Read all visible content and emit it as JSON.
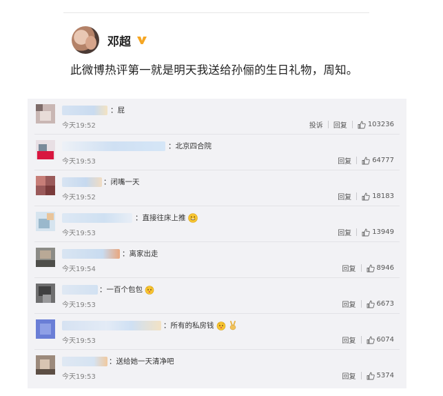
{
  "post": {
    "author": "邓超",
    "text": "此微博热评第一就是明天我送给孙俪的生日礼物，周知。"
  },
  "labels": {
    "report": "投诉",
    "reply": "回复"
  },
  "comments": [
    {
      "text": "：屁",
      "time": "今天19:52",
      "likes": "103236",
      "has_report": true
    },
    {
      "text": "：北京四合院",
      "time": "今天19:53",
      "likes": "64777"
    },
    {
      "text": "：闭嘴一天",
      "time": "今天19:52",
      "likes": "18183"
    },
    {
      "text": "：直接往床上推",
      "time": "今天19:53",
      "likes": "13949"
    },
    {
      "text": "：离家出走",
      "time": "今天19:54",
      "likes": "8946"
    },
    {
      "text": "：一百个包包",
      "time": "今天19:53",
      "likes": "6673"
    },
    {
      "text": "：所有的私房钱",
      "time": "今天19:53",
      "likes": "6074"
    },
    {
      "text": "：送给她一天清净吧",
      "time": "今天19:53",
      "likes": "5374"
    }
  ],
  "icons": {
    "verified": "verified-v-icon",
    "like": "thumbs-up-icon"
  },
  "colors": {
    "accent_verified": "#f5a623",
    "panel_bg": "#f2f2f5"
  }
}
